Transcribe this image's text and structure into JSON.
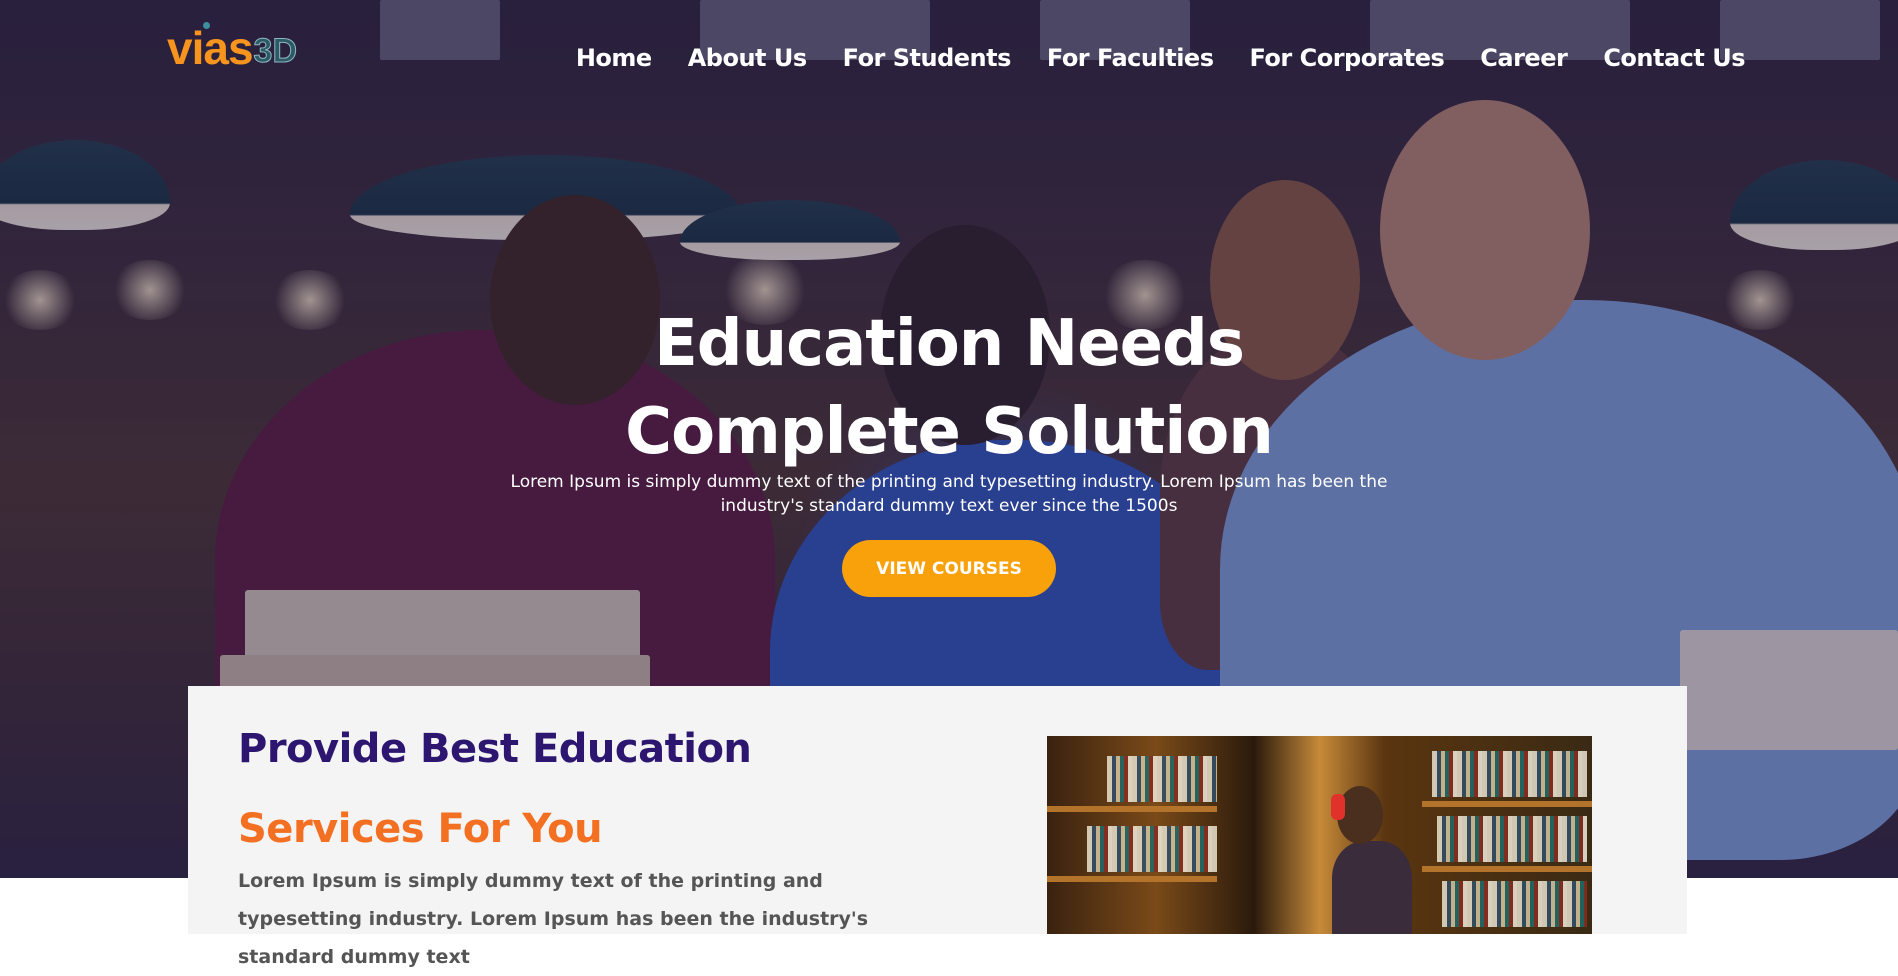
{
  "brand": {
    "name_part1": "vias",
    "name_part2": "3D",
    "accent": "#f7941d",
    "secondary": "#2c5b66"
  },
  "nav": {
    "items": [
      {
        "label": "Home"
      },
      {
        "label": "About Us"
      },
      {
        "label": "For Students"
      },
      {
        "label": "For Faculties"
      },
      {
        "label": "For Corporates"
      },
      {
        "label": "Career"
      },
      {
        "label": "Contact Us"
      }
    ]
  },
  "hero": {
    "headline_line1": "Education Needs",
    "headline_line2": "Complete Solution",
    "subtext": "Lorem Ipsum is simply dummy text of the printing and typesetting industry. Lorem Ipsum has been the industry's standard dummy text ever since the 1500s",
    "cta_label": "VIEW COURSES",
    "cta_color": "#f9a10b"
  },
  "section": {
    "title": "Provide Best Education",
    "subtitle": "Services For You",
    "body": "Lorem Ipsum is simply dummy text of the printing and typesetting industry. Lorem Ipsum has been the industry's standard dummy text",
    "title_color": "#2c1670",
    "subtitle_color": "#f36f21"
  }
}
